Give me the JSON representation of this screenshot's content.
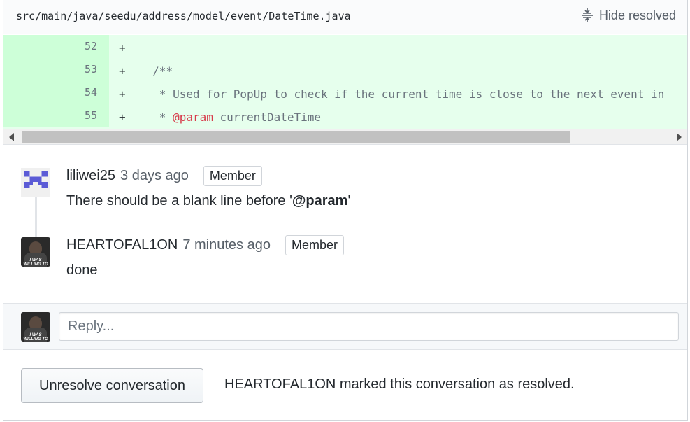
{
  "file": {
    "path": "src/main/java/seedu/address/model/event/DateTime.java",
    "hide_resolved_label": "Hide resolved"
  },
  "diff_lines": [
    {
      "number": "52",
      "plus": "+",
      "text": ""
    },
    {
      "number": "53",
      "plus": "+",
      "text": "    /**"
    },
    {
      "number": "54",
      "plus": "+",
      "text": "     * Used for PopUp to check if the current time is close to the next event in"
    },
    {
      "number": "55",
      "plus": "+",
      "prefix": "     * ",
      "tag": "@param",
      "suffix": " currentDateTime"
    }
  ],
  "comments": [
    {
      "author": "liliwei25",
      "time": "3 days ago",
      "badge": "Member",
      "body_prefix": "There should be a blank line before '",
      "body_bold": "@param",
      "body_suffix": "'"
    },
    {
      "author": "HEARTOFAL1ON",
      "time": "7 minutes ago",
      "badge": "Member",
      "body": "done",
      "avatar_caption": "I WAS WILLING TO PUT IN THE WORK"
    }
  ],
  "reply": {
    "placeholder": "Reply...",
    "avatar_caption": "I WAS WILLING TO PUT IN THE WORK"
  },
  "resolve": {
    "button_label": "Unresolve conversation",
    "resolver": "HEARTOFAL1ON",
    "message": " marked this conversation as resolved."
  },
  "colors": {
    "diff_add_bg": "#e6ffed",
    "diff_add_ln_bg": "#cdffd8",
    "param_tag": "#d73a49",
    "identicon": "#5b5bd6"
  }
}
